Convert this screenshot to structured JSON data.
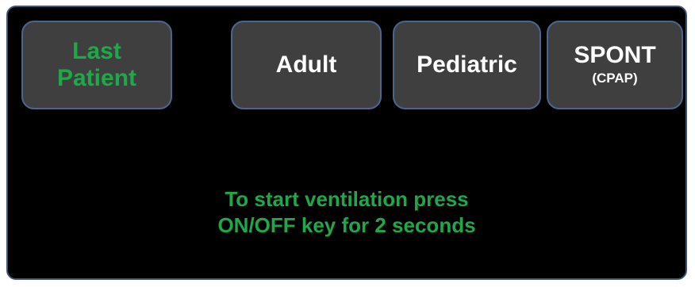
{
  "buttons": {
    "last_patient": {
      "line1": "Last",
      "line2": "Patient",
      "color": "#1fa84a"
    },
    "adult": {
      "label": "Adult"
    },
    "pediatric": {
      "label": "Pediatric"
    },
    "spont": {
      "label": "SPONT",
      "sublabel": "(CPAP)"
    }
  },
  "message": {
    "line1": "To start ventilation press",
    "line2": "ON/OFF key for 2 seconds",
    "color": "#1fa84a"
  },
  "colors": {
    "screen_background": "#000000",
    "button_background": "#3f3f3f",
    "button_border": "#4a6690",
    "accent_green": "#1fa84a"
  }
}
